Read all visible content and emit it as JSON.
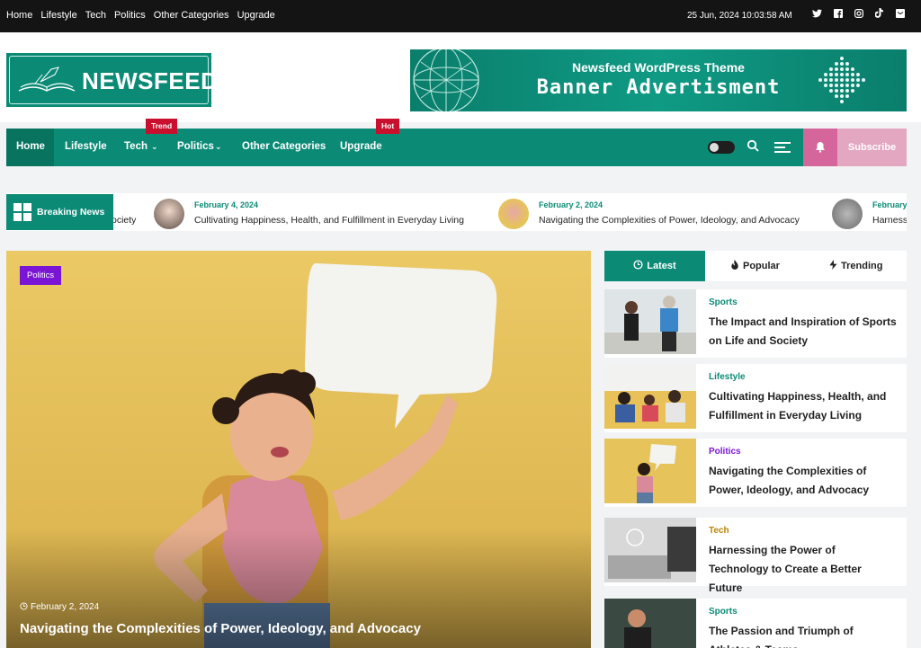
{
  "topbar": {
    "links": [
      "Home",
      "Lifestyle",
      "Tech",
      "Politics",
      "Other Categories",
      "Upgrade"
    ],
    "datetime": "25 Jun, 2024 10:03:58 AM",
    "socials": [
      "twitter-icon",
      "facebook-icon",
      "instagram-icon",
      "tiktok-icon",
      "mail-icon"
    ]
  },
  "header": {
    "logo_text": "NEWSFEED",
    "banner_line1": "Newsfeed WordPress Theme",
    "banner_line2": "Banner Advertisment"
  },
  "nav": {
    "items": [
      "Home",
      "Lifestyle",
      "Tech",
      "Politics",
      "Other Categories",
      "Upgrade"
    ],
    "badge_trend": "Trend",
    "badge_hot": "Hot",
    "subscribe": "Subscribe"
  },
  "breaking": {
    "label": "Breaking News",
    "items": [
      {
        "date": "",
        "title": "ociety"
      },
      {
        "date": "February 4, 2024",
        "title": "Cultivating Happiness, Health, and Fulfillment in Everyday Living"
      },
      {
        "date": "February 2, 2024",
        "title": "Navigating the Complexities of Power, Ideology, and Advocacy"
      },
      {
        "date": "February",
        "title": "Harness"
      }
    ]
  },
  "hero": {
    "category": "Politics",
    "date": "February 2, 2024",
    "title": "Navigating the Complexities of Power, Ideology, and Advocacy"
  },
  "sidebar": {
    "tabs": [
      "Latest",
      "Popular",
      "Trending"
    ],
    "posts": [
      {
        "category": "Sports",
        "title": "The Impact and Inspiration of Sports on Life and Society",
        "color": "#0b8b76"
      },
      {
        "category": "Lifestyle",
        "title": "Cultivating Happiness, Health, and Fulfillment in Everyday Living",
        "color": "#0b8b76"
      },
      {
        "category": "Politics",
        "title": "Navigating the Complexities of Power, Ideology, and Advocacy",
        "color": "#7a15d6"
      },
      {
        "category": "Tech",
        "title": "Harnessing the Power of Technology to Create a Better Future",
        "color": "#b8860b"
      },
      {
        "category": "Sports",
        "title": "The Passion and Triumph of Athletes & Teams",
        "color": "#0b8b76"
      }
    ]
  },
  "colors": {
    "brand": "#0b8b76",
    "hot": "#c8102e",
    "politics": "#7a15d6",
    "subscribe": "#e3a7c1"
  }
}
